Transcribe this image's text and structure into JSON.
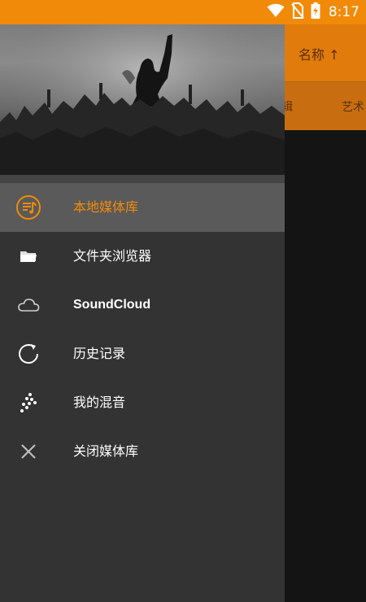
{
  "status_bar": {
    "time": "8:17",
    "icons": [
      "wifi-icon",
      "no-sim-icon",
      "battery-charging-icon"
    ],
    "color": "#f28a09"
  },
  "background_app": {
    "sort_label": "名称 ↑",
    "tabs": [
      "辑",
      "艺术"
    ],
    "toolbar_color": "#e07b0c"
  },
  "drawer": {
    "header_image": "concert-crowd-photo",
    "items": [
      {
        "label": "本地媒体库",
        "icon": "music-library-icon",
        "active": true
      },
      {
        "label": "文件夹浏览器",
        "icon": "folder-icon",
        "active": false
      },
      {
        "label": "SoundCloud",
        "icon": "cloud-icon",
        "active": false
      },
      {
        "label": "历史记录",
        "icon": "history-icon",
        "active": false
      },
      {
        "label": "我的混音",
        "icon": "mix-dots-icon",
        "active": false
      },
      {
        "label": "关闭媒体库",
        "icon": "close-icon",
        "active": false
      }
    ],
    "accent_color": "#f28a09"
  }
}
